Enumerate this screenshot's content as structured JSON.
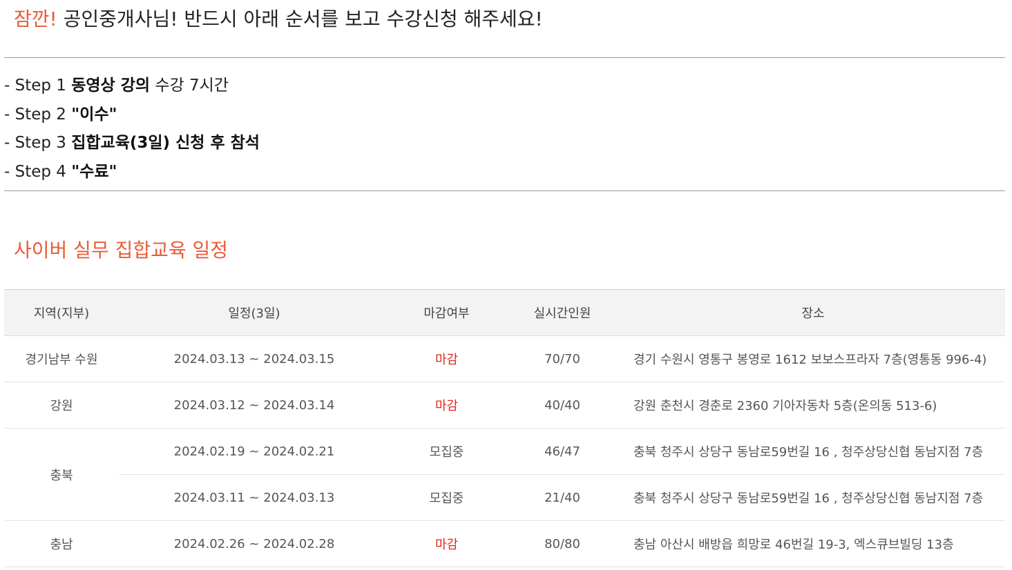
{
  "notice": {
    "accent": "잠깐!",
    "message": "공인중개사님! 반드시 아래 순서를 보고 수강신청 해주세요!"
  },
  "steps": [
    {
      "prefix": "- Step 1 ",
      "bold": "동영상 강의",
      "suffix": " 수강 7시간"
    },
    {
      "prefix": "- Step 2 ",
      "bold": "\"이수\"",
      "suffix": ""
    },
    {
      "prefix": "- Step 3 ",
      "bold": "집합교육(3일) 신청 후 참석",
      "suffix": ""
    },
    {
      "prefix": "- Step 4 ",
      "bold": "\"수료\"",
      "suffix": ""
    }
  ],
  "section_title": "사이버 실무 집합교육 일정",
  "table": {
    "headers": {
      "region": "지역(지부)",
      "schedule": "일정(3일)",
      "status": "마감여부",
      "seats": "실시간인원",
      "place": "장소"
    },
    "rows": [
      {
        "region": "경기남부 수원",
        "sessions": [
          {
            "dates": "2024.03.13 ~ 2024.03.15",
            "status": "마감",
            "seats": "70/70",
            "place": "경기 수원시 영통구 봉영로 1612 보보스프라자 7층(영통동 996-4)"
          }
        ]
      },
      {
        "region": "강원",
        "sessions": [
          {
            "dates": "2024.03.12 ~ 2024.03.14",
            "status": "마감",
            "seats": "40/40",
            "place": "강원 춘천시 경춘로 2360 기아자동차 5층(온의동 513-6)"
          }
        ]
      },
      {
        "region": "충북",
        "sessions": [
          {
            "dates": "2024.02.19 ~ 2024.02.21",
            "status": "모집중",
            "seats": "46/47",
            "place": "충북 청주시 상당구 동남로59번길 16 , 청주상당신협 동남지점 7층"
          },
          {
            "dates": "2024.03.11 ~ 2024.03.13",
            "status": "모집중",
            "seats": "21/40",
            "place": "충북 청주시 상당구 동남로59번길 16 , 청주상당신협 동남지점 7층"
          }
        ]
      },
      {
        "region": "충남",
        "sessions": [
          {
            "dates": "2024.02.26 ~ 2024.02.28",
            "status": "마감",
            "seats": "80/80",
            "place": "충남 아산시 배방읍 희망로 46번길 19-3, 엑스큐브빌딩 13층"
          }
        ]
      }
    ]
  },
  "colors": {
    "accent": "#ea5a34",
    "closed": "#e0261e",
    "header_bg": "#f3f3f3",
    "text": "#555555"
  }
}
